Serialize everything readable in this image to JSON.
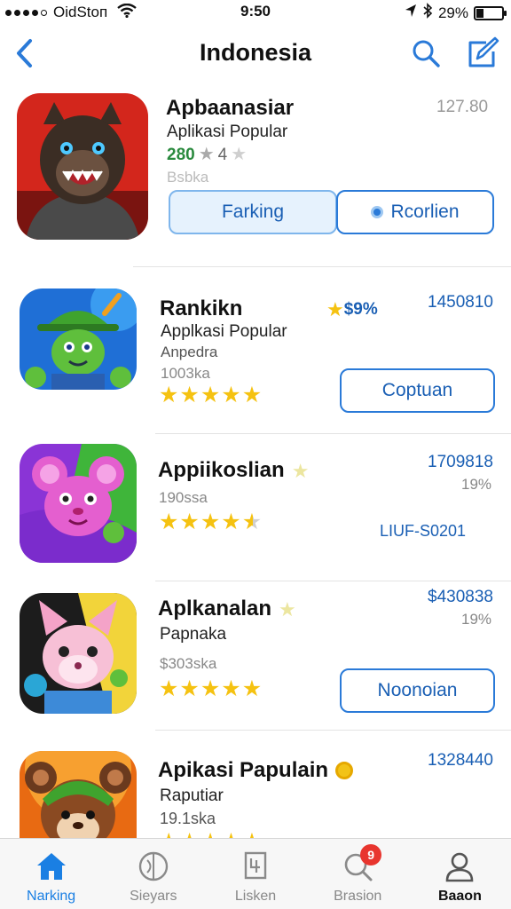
{
  "status_bar": {
    "carrier": "OidStoп",
    "time": "9:50",
    "battery": "29%",
    "battery_level": 0.29
  },
  "nav": {
    "title": "Indonesia",
    "back_icon": "chevron-left-icon",
    "search_icon": "search-icon",
    "compose_icon": "compose-icon"
  },
  "featured": {
    "name": "Apbaanasiar",
    "subtitle": "Aplikasi Popular",
    "rating_text": "280",
    "rating_count": "4",
    "meta": "Bsbka",
    "number": "127.80",
    "button_primary": "Farking",
    "button_secondary": "Rcorlien",
    "accent": "#2a7ad8"
  },
  "apps": [
    {
      "name": "Rankikn",
      "badge": "$9%",
      "number": "1450810",
      "subtitle": "Applkasi Popular",
      "subtitle2": "Anpedra",
      "meta": "1003ka",
      "rating": 5,
      "button": "Coptuan"
    },
    {
      "name": "Appiikoslian",
      "number": "1709818",
      "number2": "19%",
      "meta": "190ssa",
      "rating": 4.5,
      "link": "LIUF-S0201"
    },
    {
      "name": "Aplkanalan",
      "number": "$430838",
      "number2": "19%",
      "subtitle": "Papnaka",
      "meta": "$303ska",
      "rating": 5,
      "button": "Noonoian"
    },
    {
      "name": "Apikasi Papulain",
      "number": "1328440",
      "subtitle": "Raputiar",
      "meta": "19.1ska",
      "rating": 5
    }
  ],
  "tabs": [
    {
      "label": "Narking",
      "icon": "home-icon",
      "active": true
    },
    {
      "label": "Sieyars",
      "icon": "compass-icon"
    },
    {
      "label": "Lisken",
      "icon": "list-icon"
    },
    {
      "label": "Brasion",
      "icon": "search-icon",
      "badge": "9"
    },
    {
      "label": "Baaon",
      "icon": "person-icon"
    }
  ]
}
